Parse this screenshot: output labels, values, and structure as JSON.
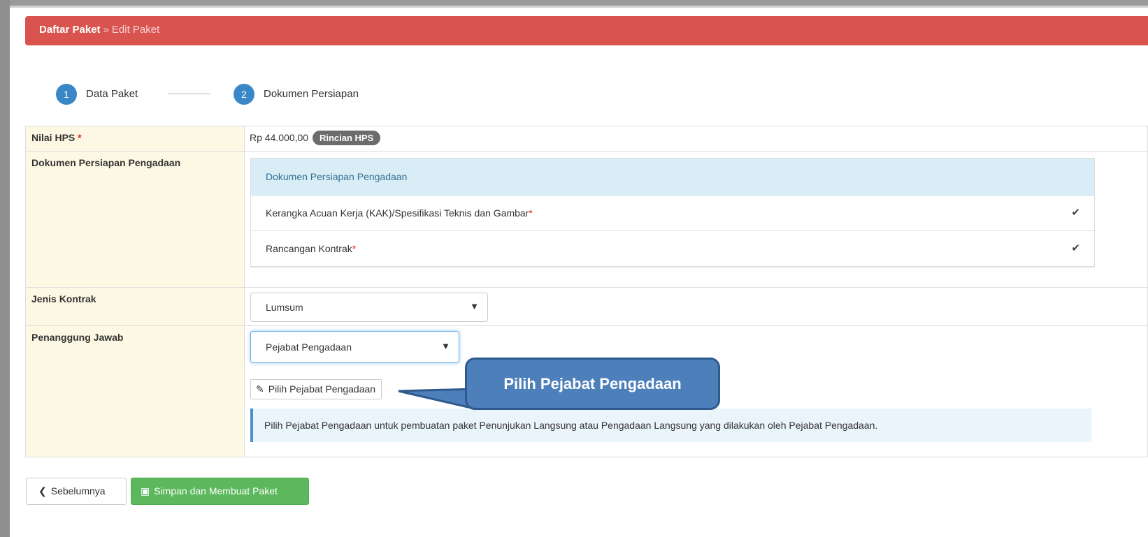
{
  "breadcrumb": {
    "root": "Daftar Paket",
    "separator": "»",
    "current": "Edit Paket"
  },
  "steps": [
    {
      "num": "1",
      "label": "Data Paket"
    },
    {
      "num": "2",
      "label": "Dokumen Persiapan"
    }
  ],
  "rows": {
    "hps": {
      "label": "Nilai HPS",
      "required": "*",
      "value": "Rp 44.000,00",
      "badge": "Rincian HPS"
    },
    "dokumen": {
      "label": "Dokumen Persiapan Pengadaan",
      "header": "Dokumen Persiapan Pengadaan",
      "items": [
        {
          "text": "Kerangka Acuan Kerja (KAK)/Spesifikasi Teknis dan Gambar",
          "required": "*",
          "check": "✔"
        },
        {
          "text": "Rancangan Kontrak",
          "required": "*",
          "check": "✔"
        }
      ]
    },
    "jenis_kontrak": {
      "label": "Jenis Kontrak",
      "selected": "Lumsum"
    },
    "penanggung_jawab": {
      "label": "Penanggung Jawab",
      "selected": "Pejabat Pengadaan",
      "button": "Pilih Pejabat Pengadaan",
      "info": "Pilih Pejabat Pengadaan untuk pembuatan paket Penunjukan Langsung atau Pengadaan Langsung yang dilakukan oleh Pejabat Pengadaan."
    }
  },
  "callout": "Pilih Pejabat Pengadaan",
  "footer": {
    "prev_label": "Sebelumnya",
    "save_label": "Simpan dan Membuat Paket"
  },
  "colors": {
    "header": "#d9534f",
    "step": "#3a87c8",
    "label_bg": "#fcf8e3",
    "callout": "#4d7fbb",
    "save": "#5cb85c"
  }
}
